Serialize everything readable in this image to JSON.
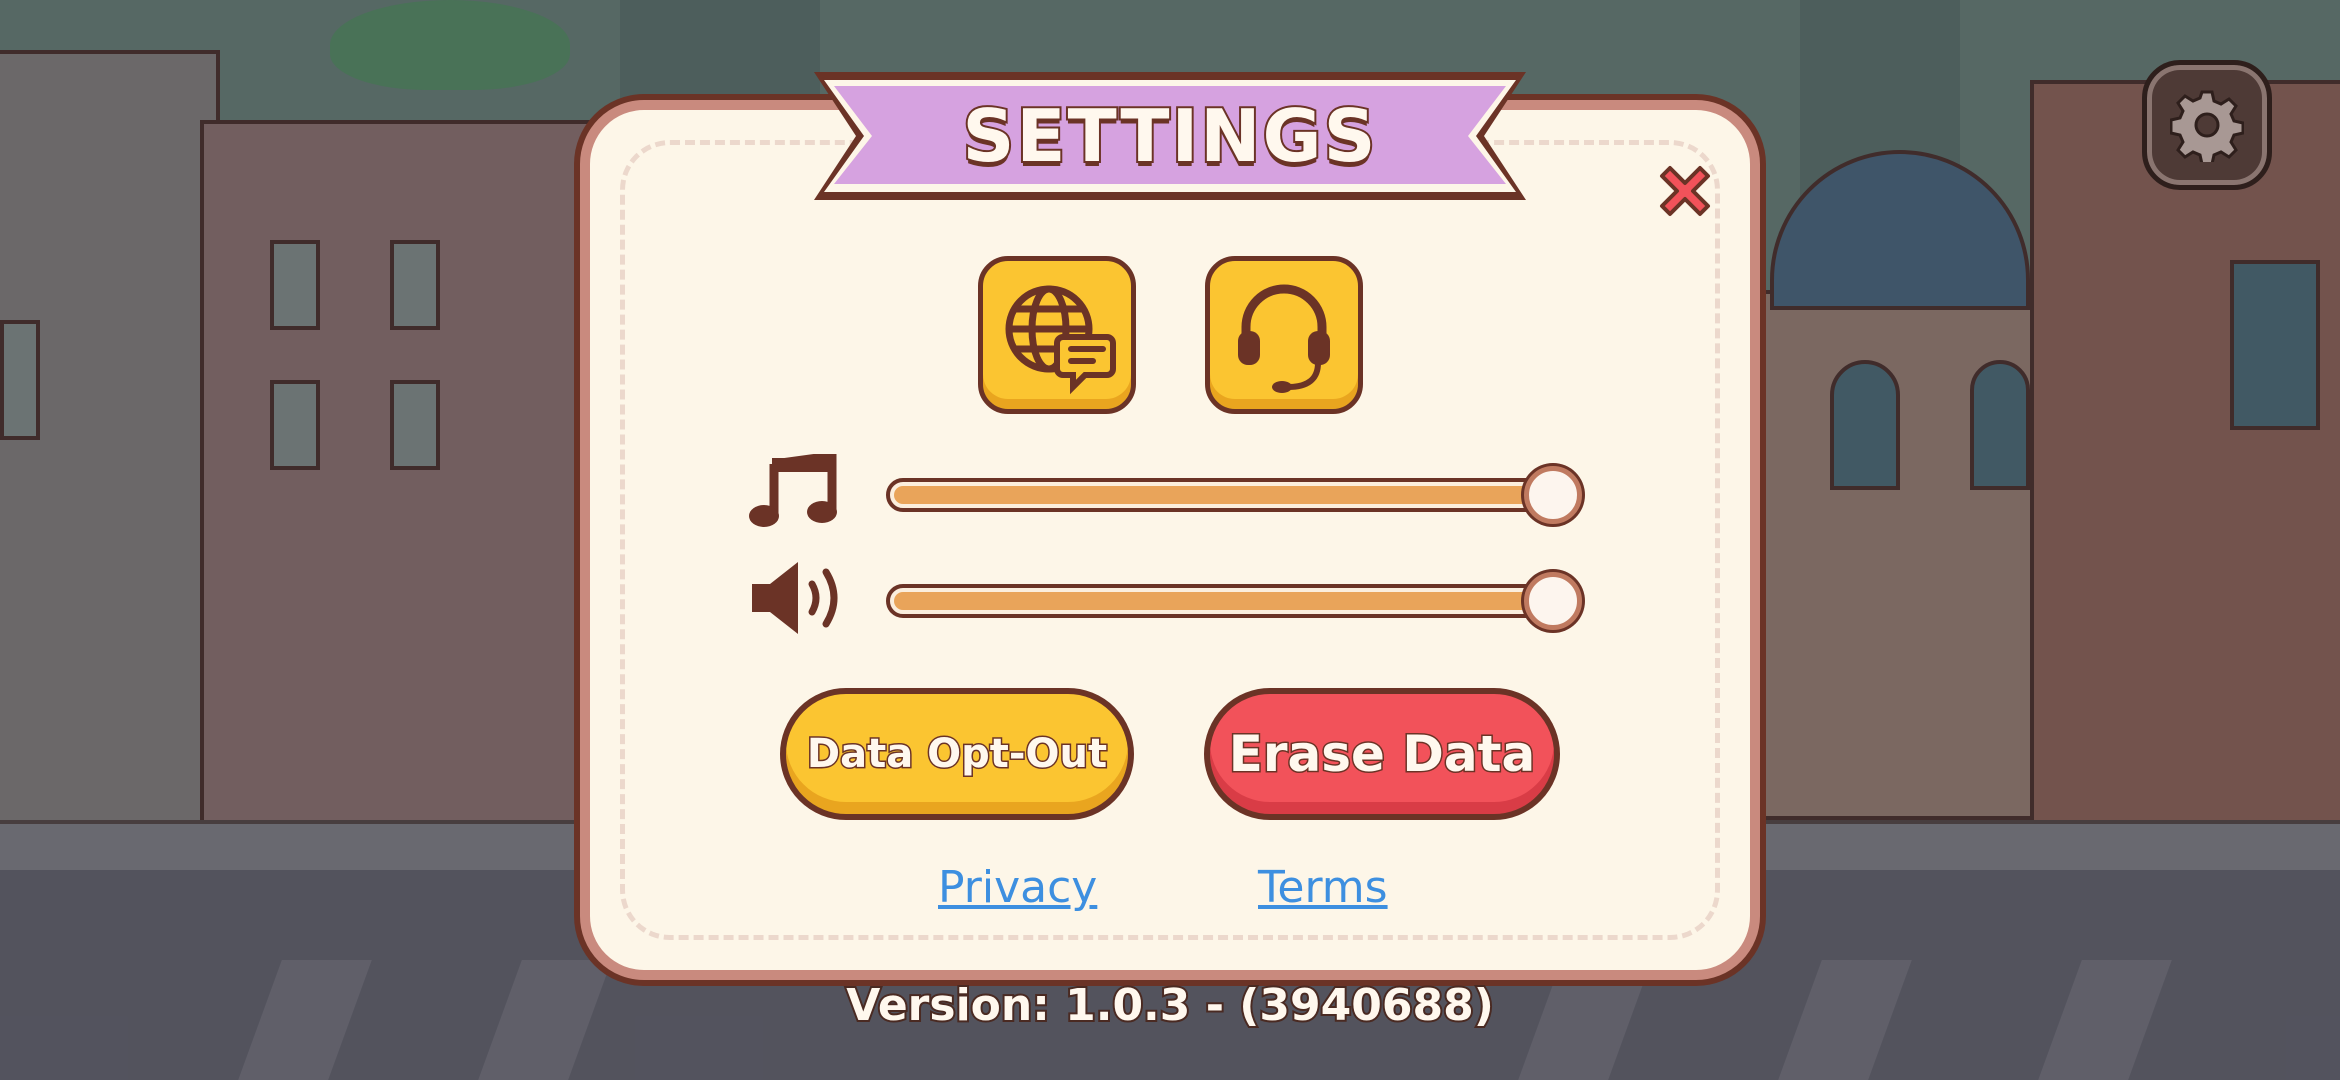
{
  "dialog": {
    "title": "SETTINGS",
    "close_icon": "close-x-icon",
    "language_button_icon": "globe-chat-icon",
    "support_button_icon": "headset-icon",
    "music_icon": "music-note-icon",
    "sound_icon": "speaker-icon",
    "music_volume": 1.0,
    "sound_volume": 1.0,
    "data_opt_out_label": "Data Opt-Out",
    "erase_data_label": "Erase Data",
    "privacy_label": "Privacy",
    "terms_label": "Terms"
  },
  "version_text": "Version: 1.0.3 - (3940688)",
  "settings_gear_icon": "gear-icon",
  "colors": {
    "accent_yellow": "#fbc531",
    "danger_red": "#f2525a",
    "banner_purple": "#d6a2e0",
    "link_blue": "#3d8fe0",
    "outline_brown": "#6b3326",
    "panel_cream": "#fdf6e8"
  }
}
